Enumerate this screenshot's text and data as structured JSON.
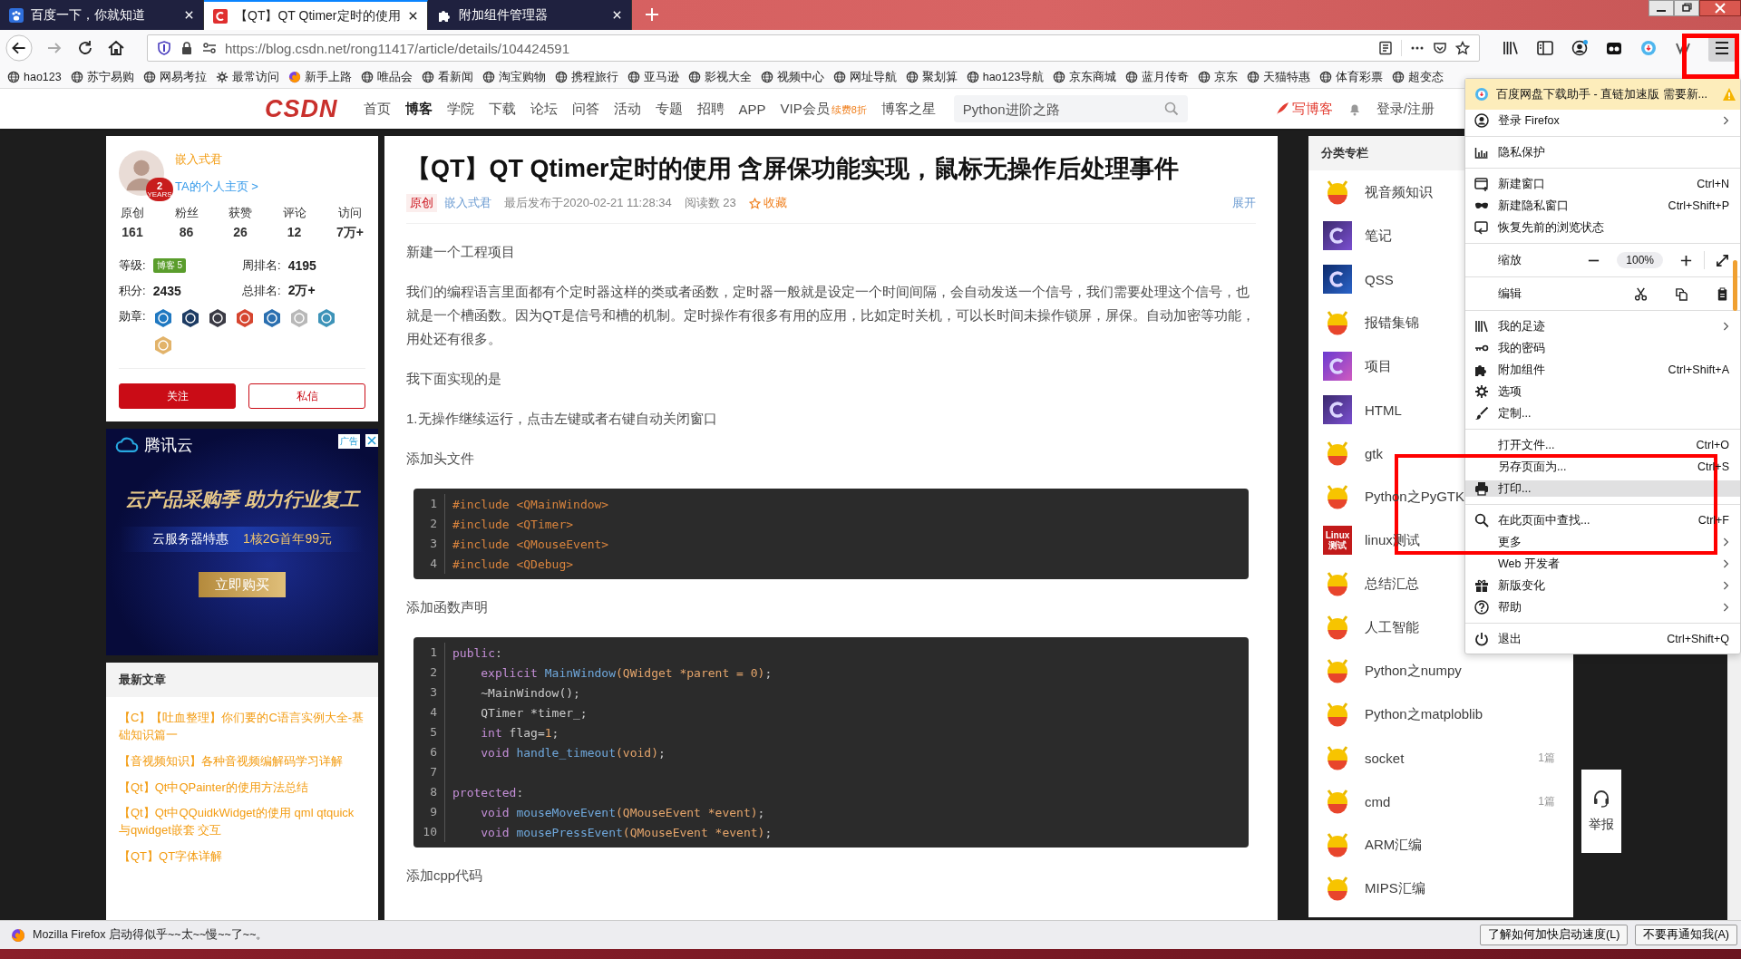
{
  "tabs": [
    {
      "title": "百度一下，你就知道",
      "kind": "paw",
      "selected": false
    },
    {
      "title": "【QT】QT Qtimer定时的使用",
      "kind": "csdn",
      "selected": true
    },
    {
      "title": "附加组件管理器",
      "kind": "puzzle",
      "selected": false
    }
  ],
  "address_bar": {
    "url": "https://blog.csdn.net/rong11417/article/details/104424591"
  },
  "bookmarks": [
    {
      "label": "hao123",
      "kind": "globe"
    },
    {
      "label": "苏宁易购",
      "kind": "globe"
    },
    {
      "label": "网易考拉",
      "kind": "globe"
    },
    {
      "label": "最常访问",
      "kind": "gear"
    },
    {
      "label": "新手上路",
      "kind": "firefox"
    },
    {
      "label": "唯品会",
      "kind": "globe"
    },
    {
      "label": "看新闻",
      "kind": "globe"
    },
    {
      "label": "淘宝购物",
      "kind": "globe"
    },
    {
      "label": "携程旅行",
      "kind": "globe"
    },
    {
      "label": "亚马逊",
      "kind": "globe"
    },
    {
      "label": "影视大全",
      "kind": "globe"
    },
    {
      "label": "视频中心",
      "kind": "globe"
    },
    {
      "label": "网址导航",
      "kind": "globe"
    },
    {
      "label": "聚划算",
      "kind": "globe"
    },
    {
      "label": "hao123导航",
      "kind": "globe"
    },
    {
      "label": "京东商城",
      "kind": "globe"
    },
    {
      "label": "蓝月传奇",
      "kind": "globe"
    },
    {
      "label": "京东",
      "kind": "globe"
    },
    {
      "label": "天猫特惠",
      "kind": "globe"
    },
    {
      "label": "体育彩票",
      "kind": "globe"
    },
    {
      "label": "超变态",
      "kind": "globe"
    }
  ],
  "site_header": {
    "logo": "CSDN",
    "nav": [
      {
        "label": "首页",
        "selected": false
      },
      {
        "label": "博客",
        "selected": true
      },
      {
        "label": "学院",
        "selected": false
      },
      {
        "label": "下载",
        "selected": false
      },
      {
        "label": "论坛",
        "selected": false
      },
      {
        "label": "问答",
        "selected": false
      },
      {
        "label": "活动",
        "selected": false
      },
      {
        "label": "专题",
        "selected": false
      },
      {
        "label": "招聘",
        "selected": false
      },
      {
        "label": "APP",
        "selected": false
      },
      {
        "label": "VIP会员",
        "badge": "续费8折",
        "selected": false
      },
      {
        "label": "博客之星",
        "selected": false
      }
    ],
    "search": {
      "placeholder": "Python进阶之路"
    },
    "write_blog": "写博客",
    "login": "登录/注册"
  },
  "profile": {
    "name": "嵌入式君",
    "years_badge": {
      "number": "2",
      "label": "YEARS"
    },
    "home_link": "TA的个人主页 >",
    "stats": [
      {
        "label": "原创",
        "value": "161"
      },
      {
        "label": "粉丝",
        "value": "86"
      },
      {
        "label": "获赞",
        "value": "26"
      },
      {
        "label": "评论",
        "value": "12"
      },
      {
        "label": "访问",
        "value": "7万+"
      }
    ],
    "level_label": "等级:",
    "level_badge": "博客 5",
    "week_rank_label": "周排名:",
    "week_rank": "4195",
    "points_label": "积分:",
    "points": "2435",
    "total_rank_label": "总排名:",
    "total_rank": "2万+",
    "medals_label": "勋章:",
    "buttons": [
      {
        "label": "关注",
        "kind": "primary"
      },
      {
        "label": "私信",
        "kind": "outline"
      }
    ]
  },
  "ad": {
    "brand": "腾讯云",
    "tag": "广告",
    "headline": "云产品采购季 助力行业复工",
    "offer_label": "云服务器特惠",
    "offer": "1核2G首年99元",
    "button": "立即购买"
  },
  "latest": {
    "title": "最新文章",
    "items": [
      "【C】【吐血整理】你们要的C语言实例大全-基础知识篇一",
      "【音视频知识】各种音视频编解码学习详解",
      "【Qt】Qt中QPainter的使用方法总结",
      "【Qt】Qt中QQuidkWidget的使用 qml qtquick与qwidget嵌套 交互",
      "【QT】QT字体详解"
    ]
  },
  "article": {
    "title": "【QT】QT Qtimer定时的使用 含屏保功能实现，鼠标无操作后处理事件",
    "tag": "原创",
    "author": "嵌入式君",
    "published": "最后发布于2020-02-21 11:28:34",
    "views": "阅读数 23",
    "favorite": "收藏",
    "expand": "展开",
    "blocks": [
      {
        "kind": "para",
        "text": "新建一个工程项目"
      },
      {
        "kind": "para",
        "text": "我们的编程语言里面都有个定时器这样的类或者函数，定时器一般就是设定一个时间间隔，会自动发送一个信号，我们需要处理这个信号，也就是一个槽函数。因为QT是信号和槽的机制。定时操作有很多有用的应用，比如定时关机，可以长时间未操作锁屏，屏保。自动加密等功能，用处还有很多。"
      },
      {
        "kind": "para",
        "text": "我下面实现的是"
      },
      {
        "kind": "para",
        "text": "1.无操作继续运行，点击左键或者右键自动关闭窗口"
      },
      {
        "kind": "para",
        "text": "添加头文件"
      },
      {
        "kind": "code",
        "lines": [
          {
            "n": "1",
            "indent": false,
            "tokens": [
              {
                "kind": "meta",
                "t": "#include <QMainWindow>"
              }
            ]
          },
          {
            "n": "2",
            "indent": false,
            "tokens": [
              {
                "kind": "meta",
                "t": "#include <QTimer>"
              }
            ]
          },
          {
            "n": "3",
            "indent": false,
            "tokens": [
              {
                "kind": "meta",
                "t": "#include <QMouseEvent>"
              }
            ]
          },
          {
            "n": "4",
            "indent": false,
            "tokens": [
              {
                "kind": "meta",
                "t": "#include <QDebug>"
              }
            ]
          }
        ]
      },
      {
        "kind": "para",
        "text": "添加函数声明"
      },
      {
        "kind": "code",
        "lines": [
          {
            "n": "1",
            "indent": false,
            "tokens": [
              {
                "kind": "kw",
                "t": "public"
              },
              {
                "kind": "plain",
                "t": ":"
              }
            ]
          },
          {
            "n": "2",
            "indent": true,
            "tokens": [
              {
                "kind": "kw",
                "t": "explicit "
              },
              {
                "kind": "fn",
                "t": "MainWindow"
              },
              {
                "kind": "param",
                "t": "(QWidget *parent = 0)"
              },
              {
                "kind": "plain",
                "t": ";"
              }
            ]
          },
          {
            "n": "3",
            "indent": true,
            "tokens": [
              {
                "kind": "plain",
                "t": "~MainWindow();"
              }
            ]
          },
          {
            "n": "4",
            "indent": true,
            "tokens": [
              {
                "kind": "plain",
                "t": "QTimer *timer_;"
              }
            ]
          },
          {
            "n": "5",
            "indent": true,
            "tokens": [
              {
                "kind": "kw",
                "t": "int "
              },
              {
                "kind": "plain",
                "t": "flag="
              },
              {
                "kind": "num",
                "t": "1"
              },
              {
                "kind": "plain",
                "t": ";"
              }
            ]
          },
          {
            "n": "6",
            "indent": true,
            "tokens": [
              {
                "kind": "kw",
                "t": "void "
              },
              {
                "kind": "fn",
                "t": "handle_timeout"
              },
              {
                "kind": "param",
                "t": "(void)"
              },
              {
                "kind": "plain",
                "t": ";"
              }
            ]
          },
          {
            "n": "7"
          },
          {
            "n": "8",
            "indent": false,
            "tokens": [
              {
                "kind": "kw",
                "t": "protected"
              },
              {
                "kind": "plain",
                "t": ":"
              }
            ]
          },
          {
            "n": "9",
            "indent": true,
            "tokens": [
              {
                "kind": "kw",
                "t": "void "
              },
              {
                "kind": "fn",
                "t": "mouseMoveEvent"
              },
              {
                "kind": "param",
                "t": "(QMouseEvent *event)"
              },
              {
                "kind": "plain",
                "t": ";"
              }
            ]
          },
          {
            "n": "10",
            "indent": true,
            "tokens": [
              {
                "kind": "kw",
                "t": "void "
              },
              {
                "kind": "fn",
                "t": "mousePressEvent"
              },
              {
                "kind": "param",
                "t": "(QMouseEvent *event)"
              },
              {
                "kind": "plain",
                "t": ";"
              }
            ]
          }
        ]
      },
      {
        "kind": "para",
        "text": "添加cpp代码"
      }
    ]
  },
  "categories": {
    "title": "分类专栏",
    "items": [
      {
        "name": "视音频知识",
        "kind": "mascot"
      },
      {
        "name": "笔记",
        "kind": "c-purple"
      },
      {
        "name": "QSS",
        "kind": "c-blue"
      },
      {
        "name": "报错集锦",
        "kind": "mascot"
      },
      {
        "name": "项目",
        "kind": "c-pink"
      },
      {
        "name": "HTML",
        "kind": "c-purple"
      },
      {
        "name": "gtk",
        "kind": "mascot"
      },
      {
        "name": "Python之PyGTK",
        "kind": "mascot"
      },
      {
        "name": "linux测试",
        "kind": "linux",
        "icon_text": [
          "Linux",
          "测试"
        ]
      },
      {
        "name": "总结汇总",
        "kind": "mascot"
      },
      {
        "name": "人工智能",
        "kind": "mascot"
      },
      {
        "name": "Python之numpy",
        "kind": "mascot"
      },
      {
        "name": "Python之matploblib",
        "kind": "mascot"
      },
      {
        "name": "socket",
        "kind": "mascot",
        "count": "1篇"
      },
      {
        "name": "cmd",
        "kind": "mascot",
        "count": "1篇"
      },
      {
        "name": "ARM汇编",
        "kind": "mascot"
      },
      {
        "name": "MIPS汇编",
        "kind": "mascot"
      }
    ]
  },
  "report_button": {
    "label": "举报"
  },
  "menu": {
    "notice": "百度网盘下载助手 - 直链加速版 需要新...",
    "items": [
      {
        "kind": "item",
        "label": "登录 Firefox",
        "submenu": true,
        "highlighted": false
      },
      {
        "kind": "separator"
      },
      {
        "kind": "item",
        "label": "隐私保护",
        "submenu": false,
        "highlighted": false
      },
      {
        "kind": "separator"
      },
      {
        "kind": "item",
        "label": "新建窗口",
        "shortcut": "Ctrl+N",
        "submenu": false,
        "highlighted": false
      },
      {
        "kind": "item",
        "label": "新建隐私窗口",
        "shortcut": "Ctrl+Shift+P",
        "submenu": false,
        "highlighted": false
      },
      {
        "kind": "item",
        "label": "恢复先前的浏览状态",
        "submenu": false,
        "highlighted": false
      },
      {
        "kind": "separator"
      },
      {
        "kind": "zoom",
        "label": "缩放",
        "value": "100%"
      },
      {
        "kind": "separator"
      },
      {
        "kind": "edit",
        "label": "编辑"
      },
      {
        "kind": "separator"
      },
      {
        "kind": "item",
        "label": "我的足迹",
        "submenu": true,
        "highlighted": false
      },
      {
        "kind": "item",
        "label": "我的密码",
        "submenu": false,
        "highlighted": false
      },
      {
        "kind": "item",
        "label": "附加组件",
        "shortcut": "Ctrl+Shift+A",
        "submenu": false,
        "highlighted": false
      },
      {
        "kind": "item",
        "label": "选项",
        "submenu": false,
        "highlighted": false
      },
      {
        "kind": "item",
        "label": "定制...",
        "submenu": false,
        "highlighted": false
      },
      {
        "kind": "separator"
      },
      {
        "kind": "item",
        "label": "打开文件...",
        "shortcut": "Ctrl+O",
        "submenu": false,
        "highlighted": false
      },
      {
        "kind": "item",
        "label": "另存页面为...",
        "shortcut": "Ctrl+S",
        "submenu": false,
        "highlighted": false
      },
      {
        "kind": "item",
        "label": "打印...",
        "submenu": false,
        "highlighted": true
      },
      {
        "kind": "separator"
      },
      {
        "kind": "item",
        "label": "在此页面中查找...",
        "shortcut": "Ctrl+F",
        "submenu": false,
        "highlighted": false
      },
      {
        "kind": "item",
        "label": "更多",
        "submenu": true,
        "highlighted": false
      },
      {
        "kind": "item",
        "label": "Web 开发者",
        "submenu": true,
        "highlighted": false
      },
      {
        "kind": "item",
        "label": "新版变化",
        "submenu": true,
        "highlighted": false
      },
      {
        "kind": "item",
        "label": "帮助",
        "submenu": true,
        "highlighted": false
      },
      {
        "kind": "separator"
      },
      {
        "kind": "item",
        "label": "退出",
        "shortcut": "Ctrl+Shift+Q",
        "submenu": false,
        "highlighted": false
      }
    ]
  },
  "notification": {
    "text": "Mozilla Firefox 启动得似乎~~太~~慢~~了~~。",
    "buttons": [
      "了解如何加快启动速度(L)",
      "不要再通知我(A)"
    ]
  }
}
